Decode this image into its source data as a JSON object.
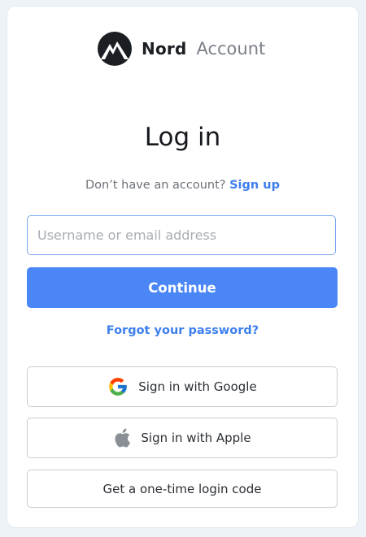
{
  "brand": {
    "name": "Nord",
    "product": "Account"
  },
  "page": {
    "title": "Log in"
  },
  "signup": {
    "prompt": "Don’t have an account?",
    "link": "Sign up"
  },
  "login": {
    "username_placeholder": "Username or email address",
    "username_value": "",
    "continue_label": "Continue",
    "forgot_label": "Forgot your password?"
  },
  "alt_methods": {
    "google_label": "Sign in with Google",
    "apple_label": "Sign in with Apple",
    "code_label": "Get a one-time login code"
  },
  "colors": {
    "accent": "#4a86f6",
    "link": "#3e7fee",
    "background": "#eef3f8",
    "text": "#16191d"
  },
  "icons": [
    "nord-logo-icon",
    "google-icon",
    "apple-icon"
  ]
}
